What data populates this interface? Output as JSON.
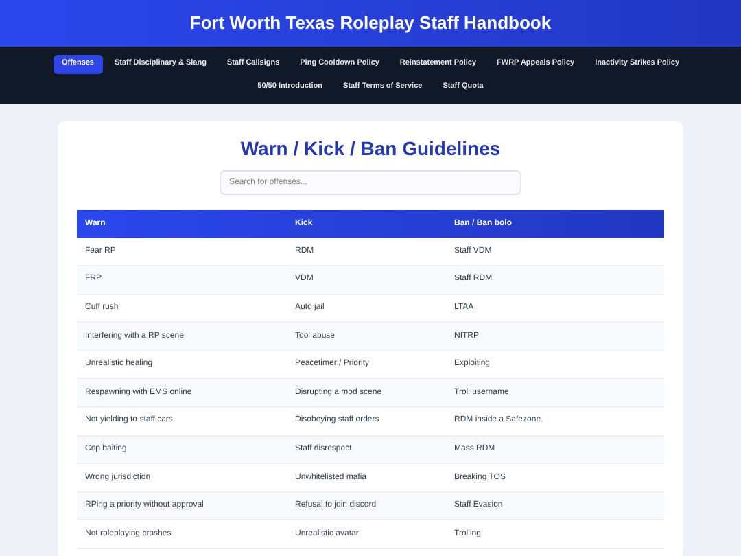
{
  "header": {
    "title": "Fort Worth Texas Roleplay Staff Handbook"
  },
  "nav": [
    {
      "label": "Offenses",
      "selected": true
    },
    {
      "label": "Staff Disciplinary & Slang",
      "selected": false
    },
    {
      "label": "Staff Callsigns",
      "selected": false
    },
    {
      "label": "Ping Cooldown Policy",
      "selected": false
    },
    {
      "label": "Reinstatement Policy",
      "selected": false
    },
    {
      "label": "FWRP Appeals Policy",
      "selected": false
    },
    {
      "label": "Inactivity Strikes Policy",
      "selected": false
    },
    {
      "label": "50/50 Introduction",
      "selected": false
    },
    {
      "label": "Staff Terms of Service",
      "selected": false
    },
    {
      "label": "Staff Quota",
      "selected": false
    }
  ],
  "section": {
    "title": "Warn / Kick / Ban Guidelines",
    "search": {
      "placeholder": "Search for offenses..."
    }
  },
  "table": {
    "columns": [
      "Warn",
      "Kick",
      "Ban / Ban bolo"
    ],
    "rows": [
      [
        "Fear RP",
        "RDM",
        "Staff VDM"
      ],
      [
        "FRP",
        "VDM",
        "Staff RDM"
      ],
      [
        "Cuff rush",
        "Auto jail",
        "LTAA"
      ],
      [
        "Interfering with a RP scene",
        "Tool abuse",
        "NITRP"
      ],
      [
        "Unrealistic healing",
        "Peacetimer / Priority",
        "Exploiting"
      ],
      [
        "Respawning with EMS online",
        "Disrupting a mod scene",
        "Troll username"
      ],
      [
        "Not yielding to staff cars",
        "Disobeying staff orders",
        "RDM inside a Safezone"
      ],
      [
        "Cop baiting",
        "Staff disrespect",
        "Mass RDM"
      ],
      [
        "Wrong jurisdiction",
        "Unwhitelisted mafia",
        "Breaking TOS"
      ],
      [
        "RPing a priority without approval",
        "Refusal to join discord",
        "Staff Evasion"
      ],
      [
        "Not roleplaying crashes",
        "Unrealistic avatar",
        "Trolling"
      ]
    ]
  }
}
